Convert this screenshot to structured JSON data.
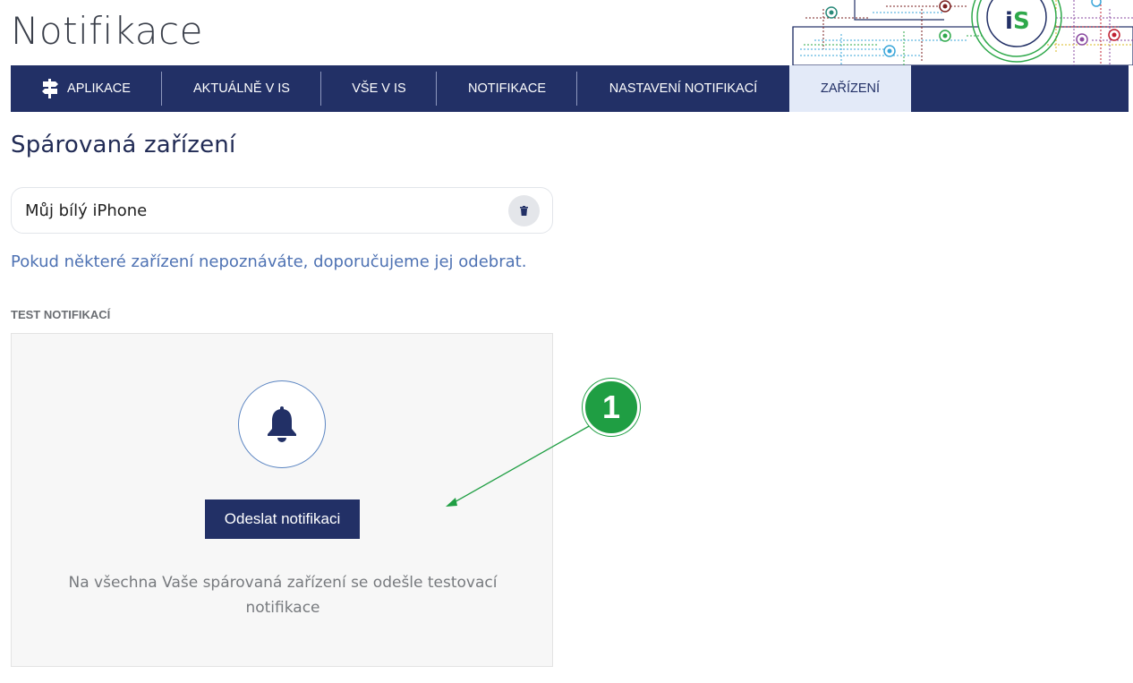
{
  "header": {
    "page_title": "Notifikace"
  },
  "nav": {
    "items": [
      {
        "label": "APLIKACE",
        "icon": "signpost-icon"
      },
      {
        "label": "AKTUÁLNĚ V IS"
      },
      {
        "label": "VŠE V IS"
      },
      {
        "label": "NOTIFIKACE"
      },
      {
        "label": "NASTAVENÍ NOTIFIKACÍ"
      },
      {
        "label": "ZAŘÍZENÍ",
        "active": true
      }
    ]
  },
  "devices": {
    "title": "Spárovaná zařízení",
    "list": [
      {
        "name": "Můj bílý iPhone",
        "icon": "trash-icon"
      }
    ],
    "hint": "Pokud některé zařízení nepoznáváte, doporučujeme jej odebrat."
  },
  "test": {
    "label": "TEST NOTIFIKACÍ",
    "icon": "bell-icon",
    "button_label": "Odeslat notifikaci",
    "description": "Na všechna Vaše spárovaná zařízení se odešle testovací notifikace"
  },
  "annotation": {
    "number": "1"
  },
  "colors": {
    "navy": "#223066",
    "active_tab_bg": "#e3eaf8",
    "link_blue": "#4e72b3",
    "annotation_green": "#1f9e43"
  }
}
